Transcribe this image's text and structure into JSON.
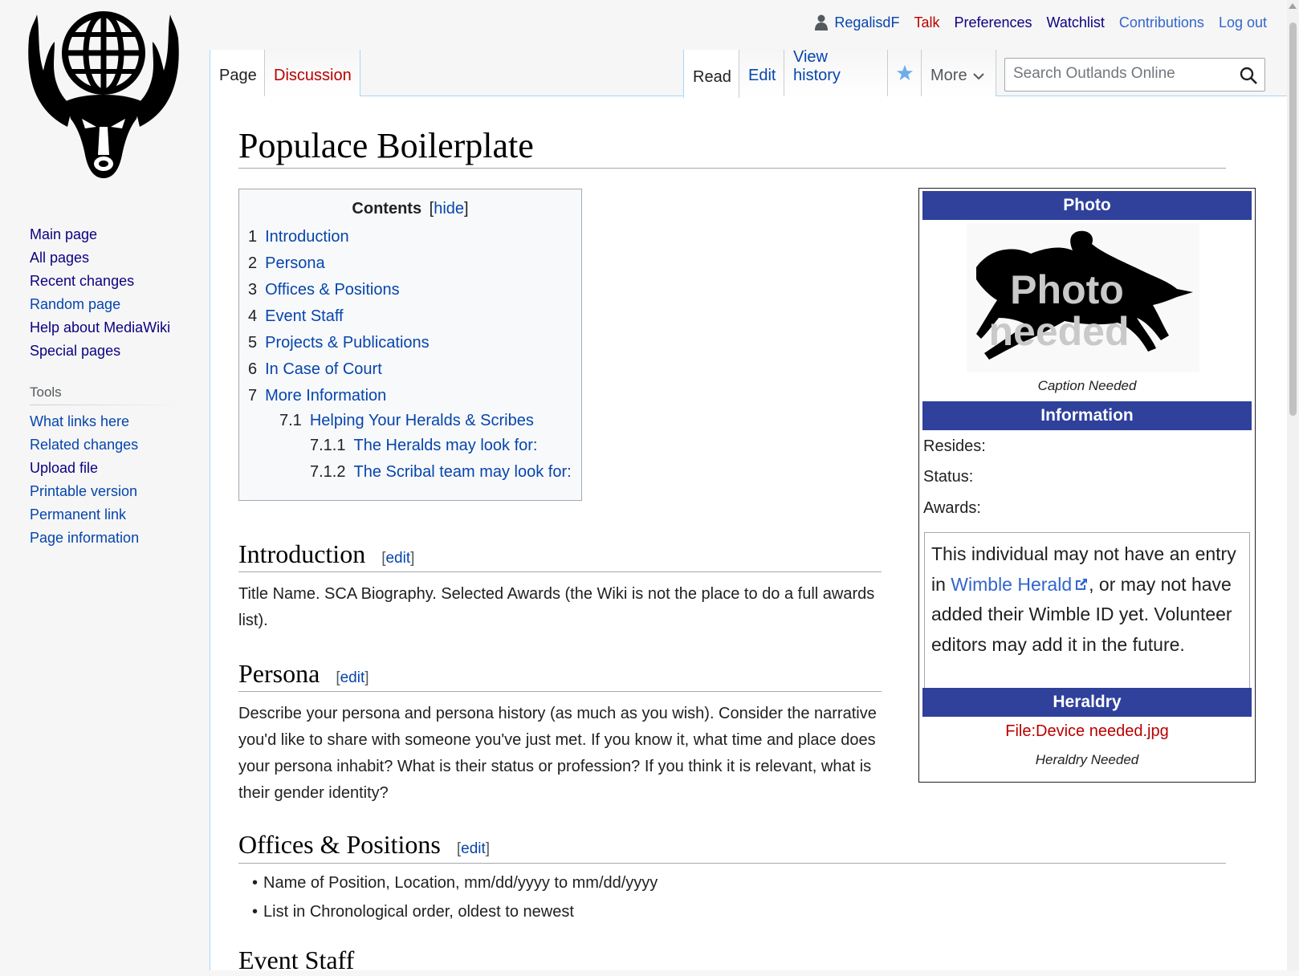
{
  "site": {
    "logo_alt": "stag-globe-logo"
  },
  "personal": {
    "username": "RegalisdF",
    "talk": "Talk",
    "preferences": "Preferences",
    "watchlist": "Watchlist",
    "contributions": "Contributions",
    "logout": "Log out"
  },
  "tabs": {
    "page": "Page",
    "discussion": "Discussion",
    "read": "Read",
    "edit": "Edit",
    "view_history": "View history",
    "more": "More"
  },
  "search": {
    "placeholder": "Search Outlands Online"
  },
  "sidebar": {
    "navigation": [
      "Main page",
      "All pages",
      "Recent changes",
      "Random page",
      "Help about MediaWiki",
      "Special pages"
    ],
    "tools_heading": "Tools",
    "tools": [
      "What links here",
      "Related changes",
      "Upload file",
      "Printable version",
      "Permanent link",
      "Page information"
    ]
  },
  "page": {
    "title": "Populace Boilerplate",
    "toc": {
      "heading": "Contents",
      "toggle_open": "[",
      "toggle": "hide",
      "toggle_close": "]",
      "items": [
        {
          "num": "1",
          "text": "Introduction"
        },
        {
          "num": "2",
          "text": "Persona"
        },
        {
          "num": "3",
          "text": "Offices & Positions"
        },
        {
          "num": "4",
          "text": "Event Staff"
        },
        {
          "num": "5",
          "text": "Projects & Publications"
        },
        {
          "num": "6",
          "text": "In Case of Court"
        },
        {
          "num": "7",
          "text": "More Information"
        },
        {
          "num": "7.1",
          "text": "Helping Your Heralds & Scribes"
        },
        {
          "num": "7.1.1",
          "text": "The Heralds may look for:"
        },
        {
          "num": "7.1.2",
          "text": "The Scribal team may look for:"
        }
      ]
    },
    "edit_open": "[",
    "edit_label": "edit",
    "edit_close": "]",
    "sections": {
      "introduction": {
        "heading": "Introduction",
        "text": "Title Name. SCA Biography. Selected Awards (the Wiki is not the place to do a full awards list)."
      },
      "persona": {
        "heading": "Persona",
        "text": "Describe your persona and persona history (as much as you wish). Consider the narrative you'd like to share with someone you've just met. If you know it, what time and place does your persona inhabit? What is their status or profession? If you think it is relevant, what is their gender identity?"
      },
      "offices": {
        "heading": "Offices & Positions",
        "bullets": [
          "Name of Position, Location, mm/dd/yyyy to mm/dd/yyyy",
          "List in Chronological order, oldest to newest"
        ]
      },
      "event_staff": {
        "heading": "Event Staff"
      }
    }
  },
  "infobox": {
    "photo_heading": "Photo",
    "photo_overlay_line1": "Photo",
    "photo_overlay_line2": "needed",
    "photo_caption": "Caption Needed",
    "info_heading": "Information",
    "resides_label": "Resides:",
    "status_label": "Status:",
    "awards_label": "Awards:",
    "awards_note_pre": "This individual may not have an entry in ",
    "awards_note_link": "Wimble Herald",
    "awards_note_post": ", or may not have added their Wimble ID yet. Volunteer editors may add it in the future.",
    "heraldry_heading": "Heraldry",
    "heraldry_file": "File:Device needed.jpg",
    "heraldry_caption": "Heraldry Needed",
    "header_color": "#2f419b"
  }
}
